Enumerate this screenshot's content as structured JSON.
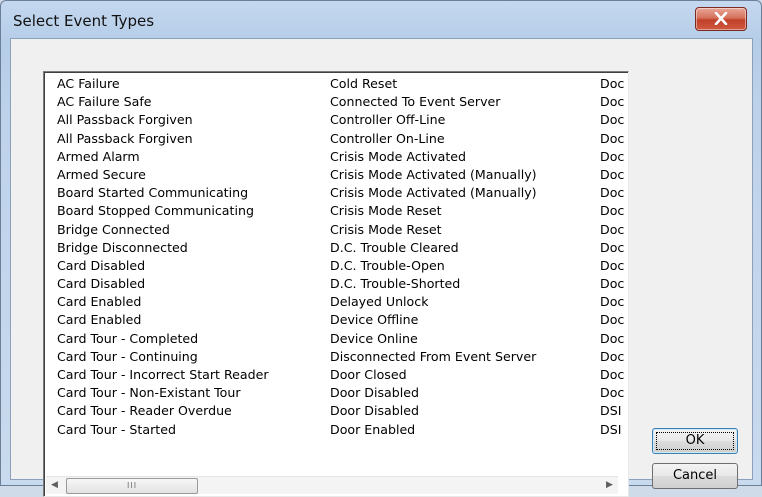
{
  "dialog": {
    "title": "Select Event Types",
    "ok_label": "OK",
    "cancel_label": "Cancel",
    "scroll_grip": "III"
  },
  "list": {
    "col1": [
      "AC Failure",
      "AC Failure Safe",
      "All Passback Forgiven",
      "All Passback Forgiven",
      "Armed Alarm",
      "Armed Secure",
      "Board Started Communicating",
      "Board Stopped Communicating",
      "Bridge Connected",
      "Bridge Disconnected",
      "Card Disabled",
      "Card Disabled",
      "Card Enabled",
      "Card Enabled",
      "Card Tour - Completed",
      "Card Tour - Continuing",
      "Card Tour - Incorrect Start Reader",
      "Card Tour - Non-Existant Tour",
      "Card Tour - Reader Overdue",
      "Card Tour - Started"
    ],
    "col2": [
      "Cold Reset",
      "Connected To Event Server",
      "Controller Off-Line",
      "Controller On-Line",
      "Crisis Mode Activated",
      "Crisis Mode Activated (Manually)",
      "Crisis Mode Activated (Manually)",
      "Crisis Mode Reset",
      "Crisis Mode Reset",
      "D.C. Trouble Cleared",
      "D.C. Trouble-Open",
      "D.C. Trouble-Shorted",
      "Delayed Unlock",
      "Device Offline",
      "Device Online",
      "Disconnected From Event Server",
      "Door Closed",
      "Door Disabled",
      "Door Disabled",
      "Door Enabled"
    ],
    "col3": [
      "Doc",
      "Doc",
      "Doc",
      "Doc",
      "Doc",
      "Doc",
      "Doc",
      "Doc",
      "Doc",
      "Doc",
      "Doc",
      "Doc",
      "Doc",
      "Doc",
      "Doc",
      "Doc",
      "Doc",
      "Doc",
      "DSI",
      "DSI"
    ]
  },
  "icons": {
    "close": "close-icon",
    "scroll_left": "scroll-left-icon",
    "scroll_right": "scroll-right-icon"
  },
  "colors": {
    "close_button": "#c2402a",
    "frame": "#b6cde8"
  }
}
